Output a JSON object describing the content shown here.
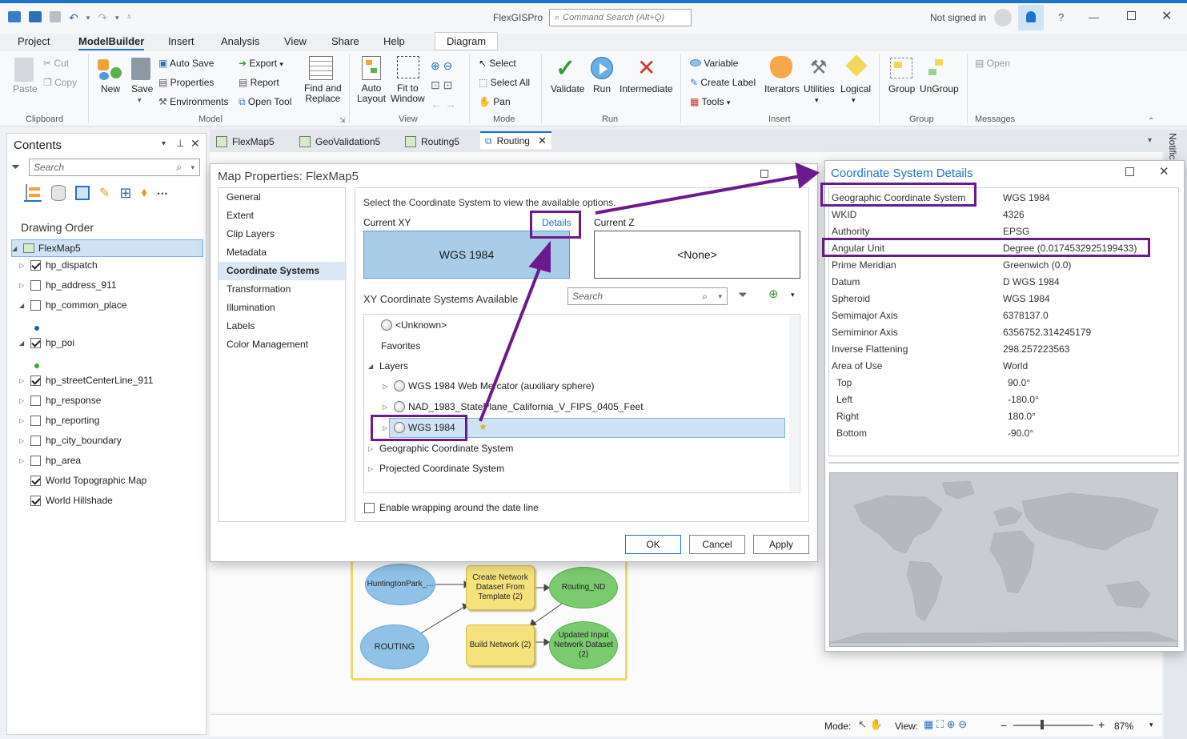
{
  "app": {
    "title": "FlexGISPro",
    "command_search": "Command Search (Alt+Q)",
    "not_signed_in": "Not signed in",
    "help": "?"
  },
  "menu": [
    "Project",
    "ModelBuilder",
    "Insert",
    "Analysis",
    "View",
    "Share",
    "Help",
    "Diagram"
  ],
  "ribbon": {
    "clipboard": {
      "paste": "Paste",
      "cut": "Cut",
      "copy": "Copy",
      "label": "Clipboard"
    },
    "model": {
      "new": "New",
      "save": "Save",
      "auto_save": "Auto Save",
      "properties": "Properties",
      "environments": "Environments",
      "export": "Export",
      "report": "Report",
      "open_tool": "Open Tool",
      "find_replace_1": "Find and",
      "find_replace_2": "Replace",
      "label": "Model"
    },
    "view": {
      "auto_layout_1": "Auto",
      "auto_layout_2": "Layout",
      "fit_1": "Fit to",
      "fit_2": "Window",
      "label": "View"
    },
    "mode": {
      "select": "Select",
      "select_all": "Select All",
      "pan": "Pan",
      "label": "Mode"
    },
    "run": {
      "validate": "Validate",
      "run": "Run",
      "intermediate": "Intermediate",
      "label": "Run"
    },
    "insert": {
      "variable": "Variable",
      "create_label": "Create Label",
      "tools": "Tools",
      "iterators": "Iterators",
      "utilities": "Utilities",
      "logical": "Logical",
      "label": "Insert"
    },
    "group": {
      "group": "Group",
      "ungroup": "UnGroup",
      "label": "Group"
    },
    "messages": {
      "open": "Open",
      "label": "Messages"
    }
  },
  "contents": {
    "title": "Contents",
    "search_placeholder": "Search",
    "drawing_order": "Drawing Order",
    "map": "FlexMap5",
    "layers": [
      {
        "name": "hp_dispatch",
        "checked": true,
        "exp": "▷"
      },
      {
        "name": "hp_address_911",
        "checked": false,
        "exp": "▷"
      },
      {
        "name": "hp_common_place",
        "checked": false,
        "exp": "◢"
      },
      {
        "name": "hp_poi",
        "checked": true,
        "exp": "◢"
      },
      {
        "name": "hp_streetCenterLine_911",
        "checked": true,
        "exp": "▷"
      },
      {
        "name": "hp_response",
        "checked": false,
        "exp": "▷"
      },
      {
        "name": "hp_reporting",
        "checked": false,
        "exp": "▷"
      },
      {
        "name": "hp_city_boundary",
        "checked": false,
        "exp": "▷"
      },
      {
        "name": "hp_area",
        "checked": false,
        "exp": "▷"
      },
      {
        "name": "World Topographic Map",
        "checked": true,
        "exp": ""
      },
      {
        "name": "World Hillshade",
        "checked": true,
        "exp": ""
      }
    ]
  },
  "doc_tabs": [
    "FlexMap5",
    "GeoValidation5",
    "Routing5",
    "Routing"
  ],
  "side_tab": "Notific",
  "map_props": {
    "title": "Map Properties: FlexMap5",
    "nav": [
      "General",
      "Extent",
      "Clip Layers",
      "Metadata",
      "Coordinate Systems",
      "Transformation",
      "Illumination",
      "Labels",
      "Color Management"
    ],
    "instruction": "Select the Coordinate System to view the available options.",
    "current_xy": "Current XY",
    "details": "Details",
    "current_z": "Current Z",
    "xy_value": "WGS 1984",
    "z_value": "<None>",
    "available": "XY Coordinate Systems Available",
    "search_placeholder": "Search",
    "tree": {
      "unknown": "<Unknown>",
      "favorites": "Favorites",
      "layers": "Layers",
      "web_merc": "WGS 1984 Web Mercator (auxiliary sphere)",
      "nad": "NAD_1983_StatePlane_California_V_FIPS_0405_Feet",
      "wgs": "WGS 1984",
      "gcs": "Geographic Coordinate System",
      "pcs": "Projected Coordinate System"
    },
    "wrap": "Enable wrapping around the date line",
    "ok": "OK",
    "cancel": "Cancel",
    "apply": "Apply"
  },
  "csd": {
    "title": "Coordinate System Details",
    "rows": [
      {
        "k": "Geographic Coordinate System",
        "v": "WGS 1984"
      },
      {
        "k": "WKID",
        "v": "4326"
      },
      {
        "k": "Authority",
        "v": "EPSG"
      },
      {
        "k": "Angular Unit",
        "v": "Degree (0.0174532925199433)"
      },
      {
        "k": "Prime Meridian",
        "v": "Greenwich (0.0)"
      },
      {
        "k": "Datum",
        "v": "D WGS 1984"
      },
      {
        "k": "Spheroid",
        "v": "WGS 1984"
      },
      {
        "k": "Semimajor Axis",
        "v": "6378137.0"
      },
      {
        "k": "Semiminor Axis",
        "v": "6356752.314245179"
      },
      {
        "k": "Inverse Flattening",
        "v": "298.257223563"
      },
      {
        "k": "Area of Use",
        "v": "World"
      },
      {
        "k": "Top",
        "v": "90.0°"
      },
      {
        "k": "Left",
        "v": "-180.0°"
      },
      {
        "k": "Right",
        "v": "180.0°"
      },
      {
        "k": "Bottom",
        "v": "-90.0°"
      }
    ]
  },
  "model": {
    "huntington": "HuntingtonPark_...",
    "create_nd": "Create Network Dataset From Template (2)",
    "routing_nd": "Routing_ND",
    "routing": "ROUTING",
    "build_nd": "Build Network (2)",
    "updated": "Updated Input Network Dataset (2)"
  },
  "status": {
    "mode": "Mode:",
    "view": "View:",
    "zoom": "87%"
  },
  "colors": {
    "highlight": "#6b1a8e",
    "selection": "#a9cde9",
    "accent": "#1d73c9"
  }
}
